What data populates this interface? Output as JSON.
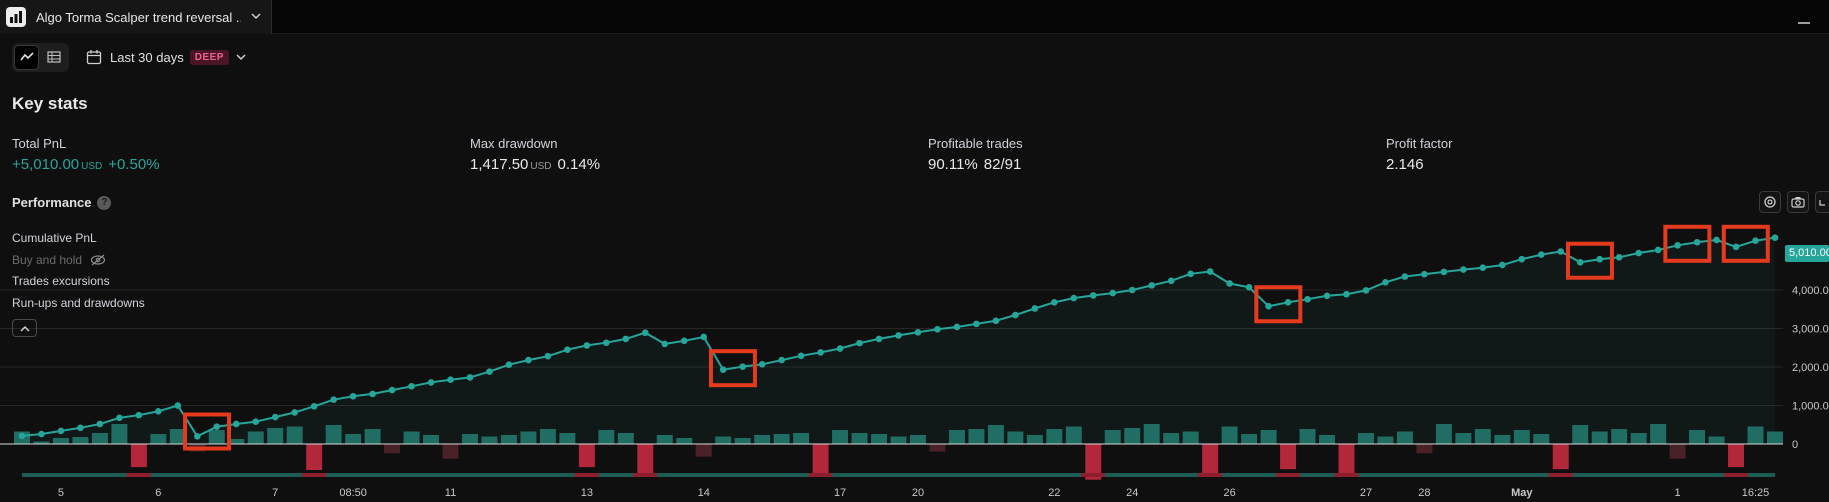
{
  "tab": {
    "title": "Algo Torma Scalper trend reversal ...",
    "icon": "chart-logo-icon"
  },
  "toolbar": {
    "range_label": "Last 30 days",
    "badge": "DEEP"
  },
  "key_stats_title": "Key stats",
  "stats": [
    {
      "label": "Total PnL",
      "value": "+5,010.00",
      "unit": "USD",
      "pct": "+0.50%"
    },
    {
      "label": "Max drawdown",
      "value": "1,417.50",
      "unit": "USD",
      "pct": "0.14%"
    },
    {
      "label": "Profitable trades",
      "value": "90.11%",
      "unit": "",
      "pct": "82/91"
    },
    {
      "label": "Profit factor",
      "value": "2.146",
      "unit": "",
      "pct": ""
    }
  ],
  "performance": {
    "title": "Performance",
    "help": "?"
  },
  "legend": {
    "cumulative": "Cumulative PnL",
    "buy_hold": "Buy and hold",
    "excursions": "Trades excursions",
    "runups": "Run-ups and drawdowns"
  },
  "colors": {
    "accent": "#26a69a",
    "negative": "#b2283a",
    "highlight": "#e53a1e",
    "badge": "#f06292"
  },
  "chart_data": {
    "type": "line",
    "last_value_label": "5,010.00",
    "y_ticks": [
      "0",
      "1,000.00",
      "2,000.00",
      "3,000.00",
      "4,000.00"
    ],
    "y_tick_values": [
      0,
      1000,
      2000,
      3000,
      4000
    ],
    "x_tick_labels": [
      "5",
      "6",
      "7",
      "08:50",
      "11",
      "13",
      "14",
      "17",
      "20",
      "22",
      "24",
      "26",
      "27",
      "28",
      "May",
      "1",
      "16:25"
    ],
    "x_tick_trade": [
      2,
      7,
      13,
      17,
      22,
      29,
      35,
      42,
      46,
      53,
      57,
      62,
      69,
      72,
      77,
      85,
      89
    ],
    "cumulative_pnl": [
      210,
      260,
      340,
      420,
      520,
      680,
      750,
      850,
      1000,
      200,
      450,
      520,
      580,
      700,
      820,
      980,
      1150,
      1240,
      1300,
      1400,
      1500,
      1600,
      1670,
      1730,
      1880,
      2060,
      2180,
      2280,
      2450,
      2560,
      2630,
      2730,
      2890,
      2600,
      2680,
      2780,
      1930,
      2010,
      2070,
      2180,
      2290,
      2380,
      2480,
      2620,
      2730,
      2820,
      2900,
      2980,
      3040,
      3120,
      3200,
      3350,
      3520,
      3680,
      3790,
      3860,
      3920,
      4000,
      4120,
      4240,
      4420,
      4480,
      4170,
      4070,
      3580,
      3680,
      3760,
      3850,
      3890,
      3990,
      4200,
      4350,
      4410,
      4470,
      4530,
      4580,
      4650,
      4800,
      4920,
      5000,
      4720,
      4800,
      4850,
      4960,
      5040,
      5160,
      5240,
      5300,
      5120,
      5280,
      5360
    ],
    "highlighted_dips": [
      9,
      36,
      64,
      80,
      88,
      85
    ],
    "trade_bars": [
      25,
      5,
      12,
      14,
      22,
      40,
      -55,
      20,
      30,
      -18,
      28,
      10,
      25,
      32,
      35,
      -62,
      38,
      20,
      30,
      -22,
      25,
      18,
      -35,
      20,
      15,
      18,
      25,
      30,
      22,
      -55,
      28,
      22,
      -75,
      18,
      12,
      -30,
      15,
      12,
      18,
      20,
      22,
      -70,
      28,
      22,
      20,
      15,
      18,
      -18,
      28,
      30,
      38,
      25,
      18,
      30,
      35,
      -85,
      28,
      32,
      40,
      22,
      25,
      -70,
      35,
      20,
      28,
      -60,
      30,
      18,
      -78,
      22,
      15,
      25,
      -22,
      40,
      22,
      30,
      18,
      28,
      20,
      -60,
      38,
      25,
      30,
      22,
      40,
      -35,
      28,
      15,
      -55,
      35,
      25
    ]
  }
}
